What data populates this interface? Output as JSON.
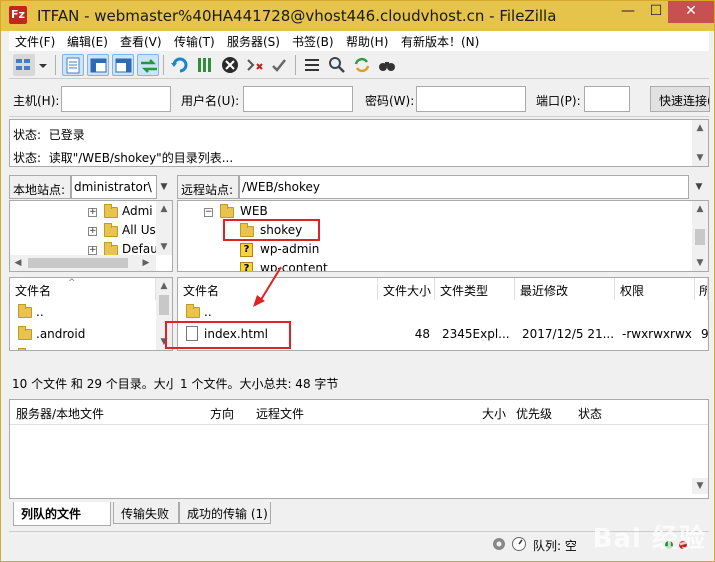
{
  "window": {
    "title": "ITFAN - webmaster%40HA441728@vhost446.cloudvhost.cn - FileZilla",
    "app_icon_letter": "Fz",
    "minimize": "—",
    "maximize": "☐",
    "close": "✕"
  },
  "menu": [
    "文件(F)",
    "编辑(E)",
    "查看(V)",
    "传输(T)",
    "服务器(S)",
    "书签(B)",
    "帮助(H)",
    "有新版本！(N)"
  ],
  "quickconnect": {
    "host_label": "主机(H):",
    "user_label": "用户名(U):",
    "pass_label": "密码(W):",
    "port_label": "端口(P):",
    "button": "快速连接(Q)"
  },
  "log": [
    {
      "prefix": "状态:",
      "text": "已登录"
    },
    {
      "prefix": "状态:",
      "text": "读取\"/WEB/shokey\"的目录列表..."
    }
  ],
  "local": {
    "site_label": "本地站点:",
    "site_path": "dministrator\\",
    "tree": [
      "Admi",
      "All Us",
      "Defau"
    ],
    "columns": [
      "文件名"
    ],
    "files": [
      "..",
      ".android",
      ""
    ],
    "status": "10 个文件 和 29 个目录。大小"
  },
  "remote": {
    "site_label": "远程站点:",
    "site_path": "/WEB/shokey",
    "tree": [
      {
        "name": "WEB",
        "type": "folder"
      },
      {
        "name": "shokey",
        "type": "folder"
      },
      {
        "name": "wp-admin",
        "type": "unknown"
      },
      {
        "name": "wp-content",
        "type": "unknown"
      }
    ],
    "columns": [
      "文件名",
      "文件大小",
      "文件类型",
      "最近修改",
      "权限",
      "所"
    ],
    "files": [
      {
        "name": "..",
        "size": "",
        "type": "",
        "modified": "",
        "perm": "",
        "owner": ""
      },
      {
        "name": "index.html",
        "size": "48",
        "type": "2345Expl...",
        "modified": "2017/12/5 21...",
        "perm": "-rwxrwxrwx",
        "owner": "9"
      }
    ],
    "status": "1 个文件。大小总共: 48 字节"
  },
  "queue": {
    "columns": [
      "服务器/本地文件",
      "方向",
      "远程文件",
      "大小",
      "优先级",
      "状态"
    ]
  },
  "tabs": [
    "列队的文件",
    "传输失败",
    "成功的传输 (1)"
  ],
  "footer": {
    "queue_label": "队列: 空"
  },
  "watermark": "Bai 经验"
}
